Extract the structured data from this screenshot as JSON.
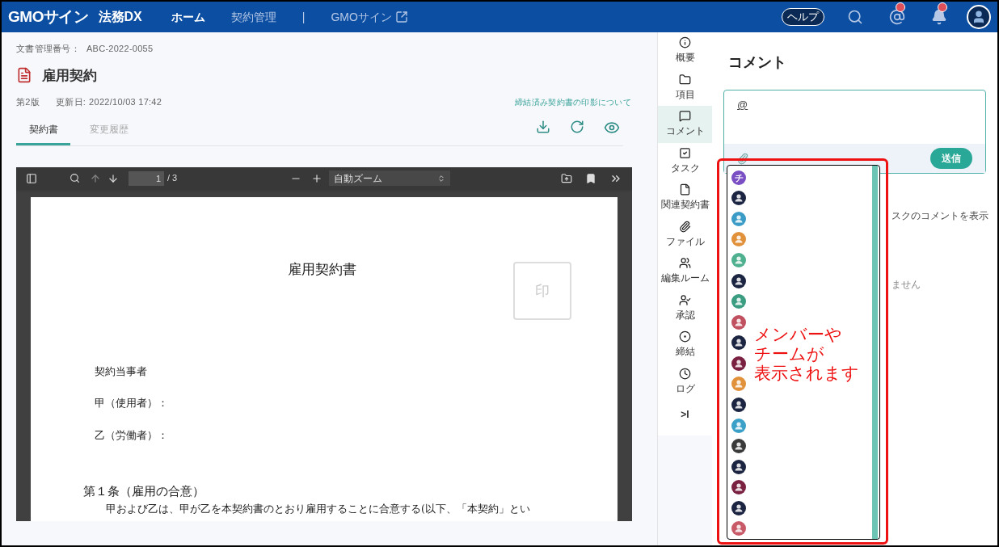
{
  "header": {
    "logo": "GMOサイン",
    "product": "法務DX",
    "nav": [
      {
        "label": "ホーム",
        "selected": true
      },
      {
        "label": "契約管理",
        "selected": false
      }
    ],
    "separator": "|",
    "external_link": "GMOサイン",
    "help": "ヘルプ",
    "mention_badge": true,
    "bell_badge": true
  },
  "document": {
    "number_label": "文書管理番号：",
    "number": "ABC-2022-0055",
    "title": "雇用契約",
    "version": "第2版",
    "updated_label": "更新日:",
    "updated": "2022/10/03 17:42",
    "seal_link": "締結済み契約書の印影について",
    "tabs": [
      {
        "label": "契約書",
        "selected": true
      },
      {
        "label": "変更履歴",
        "selected": false
      }
    ]
  },
  "viewer": {
    "page": "1",
    "page_count": "/ 3",
    "zoom": "自動ズーム",
    "page_content": {
      "title": "雇用契約書",
      "stamp": "印",
      "parties_heading": "契約当事者",
      "party_a": "甲（使用者）：",
      "party_b": "乙（労働者）：",
      "article": "第１条（雇用の合意）",
      "article_text": "甲および乙は、甲が乙を本契約書のとおり雇用することに合意する(以下、「本契約」とい"
    }
  },
  "sidebar": {
    "items": [
      {
        "label": "概要",
        "selected": false
      },
      {
        "label": "項目",
        "selected": false
      },
      {
        "label": "コメント",
        "selected": true
      },
      {
        "label": "タスク",
        "selected": false
      },
      {
        "label": "関連契約書",
        "selected": false
      },
      {
        "label": "ファイル",
        "selected": false
      },
      {
        "label": "編集ルーム",
        "selected": false
      },
      {
        "label": "承認",
        "selected": false
      },
      {
        "label": "締結",
        "selected": false
      },
      {
        "label": "ログ",
        "selected": false
      }
    ],
    "collapse": ">I"
  },
  "comments": {
    "title": "コメント",
    "input_value": "@",
    "send": "送信",
    "show_task_comments": "スクのコメントを表示",
    "empty": "ません",
    "mention_list": [
      {
        "kind": "team",
        "initial": "チ",
        "color": "#7a4fc4"
      },
      {
        "kind": "member",
        "color": "#1b2440"
      },
      {
        "kind": "member",
        "color": "#3a9cc6"
      },
      {
        "kind": "member",
        "color": "#e0913a"
      },
      {
        "kind": "member",
        "color": "#4fb08f"
      },
      {
        "kind": "member",
        "color": "#1b2440"
      },
      {
        "kind": "member",
        "color": "#3a9c80"
      },
      {
        "kind": "member",
        "color": "#c05060"
      },
      {
        "kind": "member",
        "color": "#1b2440"
      },
      {
        "kind": "member",
        "color": "#7a2040"
      },
      {
        "kind": "member",
        "color": "#e0913a"
      },
      {
        "kind": "member",
        "color": "#1b2440"
      },
      {
        "kind": "member",
        "color": "#3aa0c8"
      },
      {
        "kind": "member",
        "color": "#3a3a3a"
      },
      {
        "kind": "member",
        "color": "#1b2440"
      },
      {
        "kind": "member",
        "color": "#7a2040"
      },
      {
        "kind": "member",
        "color": "#1b2440"
      },
      {
        "kind": "member",
        "color": "#c85a68"
      }
    ]
  },
  "annotation": {
    "lines": [
      "メンバーや",
      "チームが",
      "表示されます"
    ]
  }
}
